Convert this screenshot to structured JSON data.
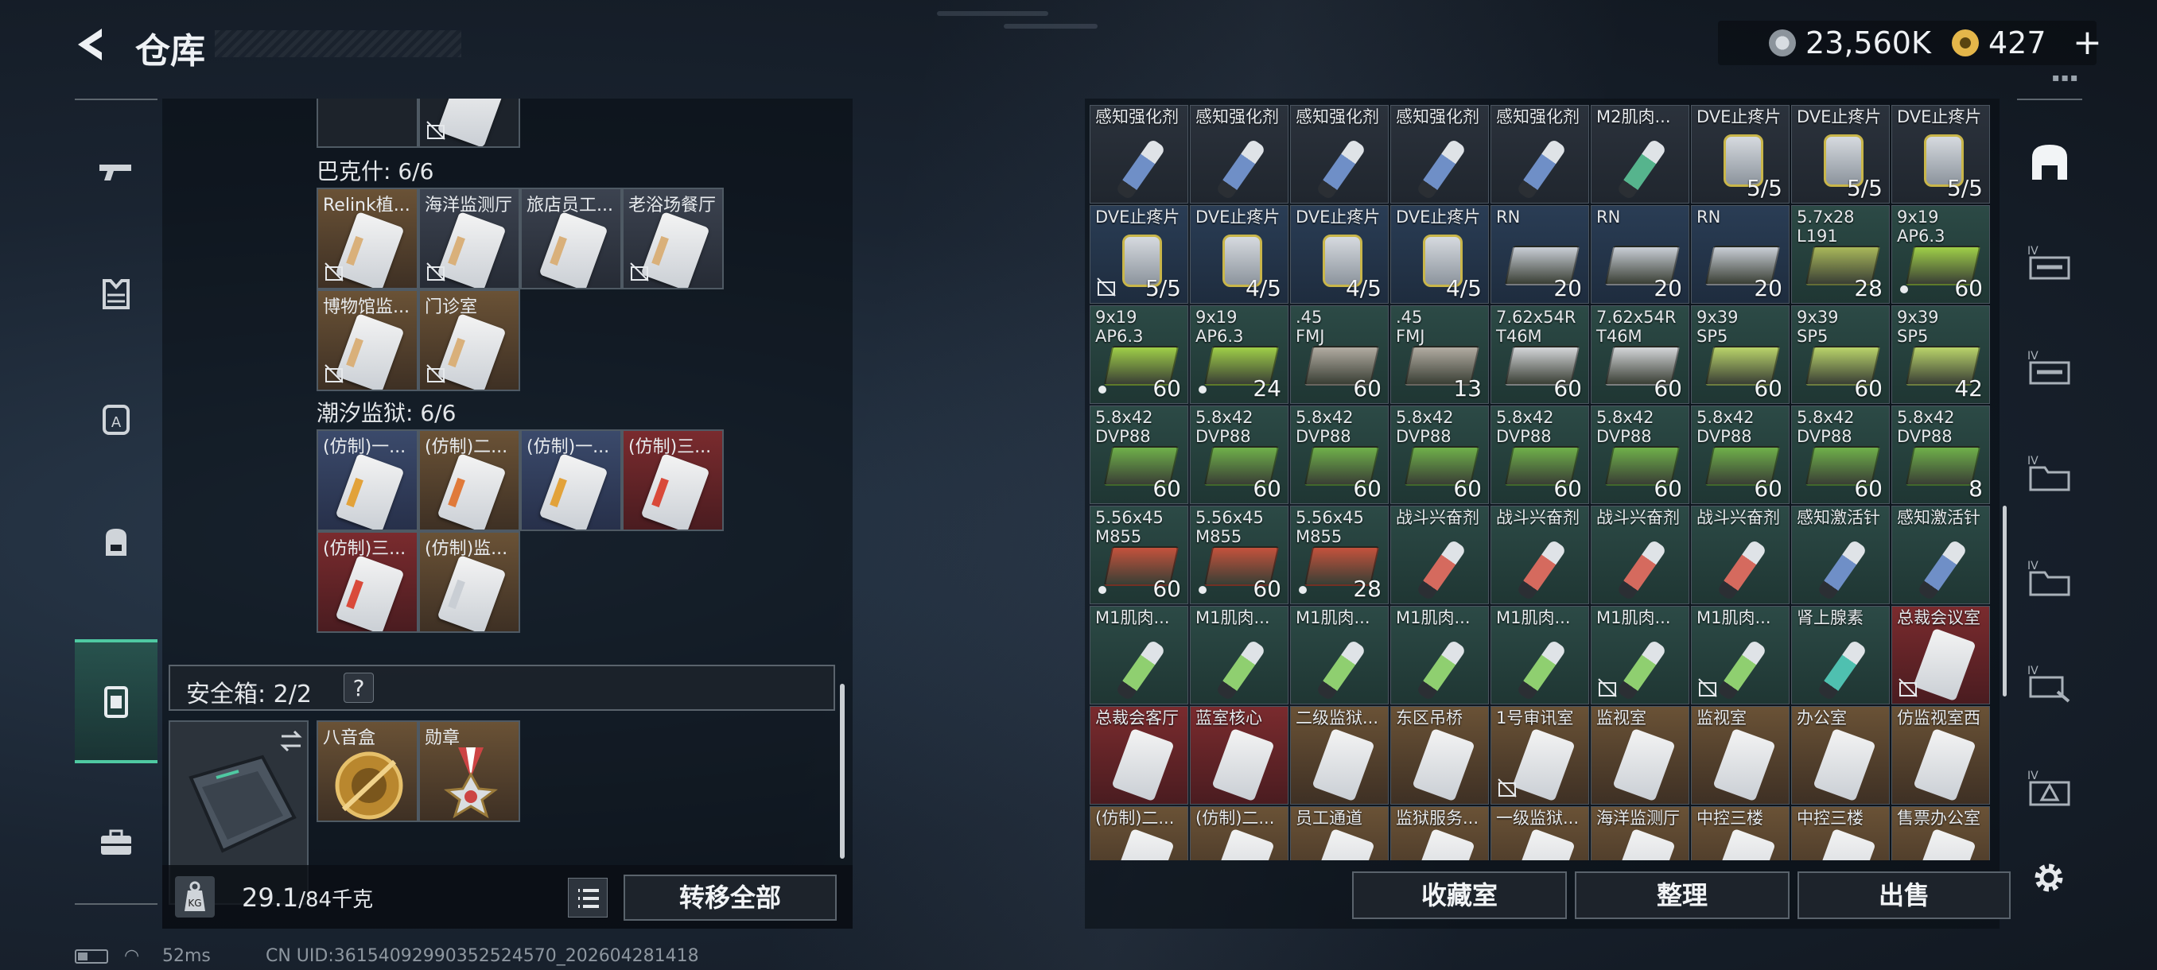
{
  "header": {
    "title": "仓库",
    "silver": "23,560K",
    "gold": "427",
    "plus": "+"
  },
  "status": {
    "ping": "52ms",
    "uid": "CN UID:36154092990352524570_202604281418"
  },
  "left": {
    "sections": [
      {
        "title": "巴克什: 6/6",
        "items": [
          {
            "label": "Relink植...",
            "color": "brown",
            "locked": true
          },
          {
            "label": "海洋监测厅",
            "color": "grey",
            "locked": true
          },
          {
            "label": "旅店员工...",
            "color": "grey",
            "locked": false
          },
          {
            "label": "老浴场餐厅",
            "color": "grey",
            "locked": true
          },
          {
            "label": "博物馆监...",
            "color": "brown",
            "locked": true
          },
          {
            "label": "门诊室",
            "color": "brown",
            "locked": true
          }
        ]
      },
      {
        "title": "潮汐监狱: 6/6",
        "items": [
          {
            "label": "(仿制)一...",
            "color": "blue",
            "locked": false
          },
          {
            "label": "(仿制)二...",
            "color": "brown",
            "locked": false
          },
          {
            "label": "(仿制)一...",
            "color": "blue",
            "locked": false
          },
          {
            "label": "(仿制)三...",
            "color": "red",
            "locked": false
          },
          {
            "label": "(仿制)三...",
            "color": "red",
            "locked": false
          },
          {
            "label": "(仿制)监...",
            "color": "brown",
            "locked": false
          }
        ]
      }
    ],
    "safebox": {
      "label": "安全箱: 2/2",
      "help": "?",
      "items": [
        {
          "label": "八音盒"
        },
        {
          "label": "勋章"
        }
      ]
    },
    "weight": {
      "current": "29.1",
      "max": "/84千克"
    },
    "transfer_all": "转移全部"
  },
  "right": {
    "rows": [
      [
        {
          "l": "感知强化剂",
          "c": "",
          "k": "syr",
          "bg": "dark",
          "t": "#6f8fc7"
        },
        {
          "l": "感知强化剂",
          "c": "",
          "k": "syr",
          "bg": "dark",
          "t": "#6f8fc7"
        },
        {
          "l": "感知强化剂",
          "c": "",
          "k": "syr",
          "bg": "dark",
          "t": "#6f8fc7"
        },
        {
          "l": "感知强化剂",
          "c": "",
          "k": "syr",
          "bg": "dark",
          "t": "#6f8fc7"
        },
        {
          "l": "感知强化剂",
          "c": "",
          "k": "syr",
          "bg": "dark",
          "t": "#6f8fc7"
        },
        {
          "l": "M2肌肉...",
          "c": "",
          "k": "syr",
          "bg": "dark",
          "t": "#56b48d"
        },
        {
          "l": "DVE止疼片",
          "c": "5/5",
          "k": "pill",
          "bg": "dark"
        },
        {
          "l": "DVE止疼片",
          "c": "5/5",
          "k": "pill",
          "bg": "dark"
        },
        {
          "l": "DVE止疼片",
          "c": "5/5",
          "k": "pill",
          "bg": "dark"
        }
      ],
      [
        {
          "l": "DVE止疼片",
          "c": "5/5",
          "k": "pill",
          "bg": "blue",
          "lock": true
        },
        {
          "l": "DVE止疼片",
          "c": "4/5",
          "k": "pill",
          "bg": "blue"
        },
        {
          "l": "DVE止疼片",
          "c": "4/5",
          "k": "pill",
          "bg": "blue"
        },
        {
          "l": "DVE止疼片",
          "c": "4/5",
          "k": "pill",
          "bg": "blue"
        },
        {
          "l": "RN",
          "c": "20",
          "k": "box",
          "bg": "blue",
          "t": "#c9ced6"
        },
        {
          "l": "RN",
          "c": "20",
          "k": "box",
          "bg": "blue",
          "t": "#c9ced6"
        },
        {
          "l": "RN",
          "c": "20",
          "k": "box",
          "bg": "blue",
          "t": "#c9ced6"
        },
        {
          "l": "5.7x28\nL191",
          "c": "28",
          "k": "box",
          "bg": "green",
          "t": "#a9b85a"
        },
        {
          "l": "9x19\nAP6.3",
          "c": "60",
          "k": "box",
          "bg": "green",
          "t": "#9fcf48",
          "dot": true
        }
      ],
      [
        {
          "l": "9x19\nAP6.3",
          "c": "60",
          "k": "box",
          "bg": "green",
          "t": "#9fcf48",
          "dot": true
        },
        {
          "l": "9x19\nAP6.3",
          "c": "24",
          "k": "box",
          "bg": "green",
          "t": "#9fcf48",
          "dot": true
        },
        {
          "l": ".45\nFMJ",
          "c": "60",
          "k": "box",
          "bg": "green",
          "t": "#b2aca2"
        },
        {
          "l": ".45\nFMJ",
          "c": "13",
          "k": "box",
          "bg": "green",
          "t": "#b2aca2"
        },
        {
          "l": "7.62x54R\nT46M",
          "c": "60",
          "k": "box",
          "bg": "green",
          "t": "#d4d6d9"
        },
        {
          "l": "7.62x54R\nT46M",
          "c": "60",
          "k": "box",
          "bg": "green",
          "t": "#d4d6d9"
        },
        {
          "l": "9x39\nSP5",
          "c": "60",
          "k": "box",
          "bg": "green",
          "t": "#b9d46a"
        },
        {
          "l": "9x39\nSP5",
          "c": "60",
          "k": "box",
          "bg": "green",
          "t": "#b9d46a"
        },
        {
          "l": "9x39\nSP5",
          "c": "42",
          "k": "box",
          "bg": "green",
          "t": "#b9d46a"
        }
      ],
      [
        {
          "l": "5.8x42\nDVP88",
          "c": "60",
          "k": "box",
          "bg": "green",
          "t": "#6fb04a"
        },
        {
          "l": "5.8x42\nDVP88",
          "c": "60",
          "k": "box",
          "bg": "green",
          "t": "#6fb04a"
        },
        {
          "l": "5.8x42\nDVP88",
          "c": "60",
          "k": "box",
          "bg": "green",
          "t": "#6fb04a"
        },
        {
          "l": "5.8x42\nDVP88",
          "c": "60",
          "k": "box",
          "bg": "green",
          "t": "#6fb04a"
        },
        {
          "l": "5.8x42\nDVP88",
          "c": "60",
          "k": "box",
          "bg": "green",
          "t": "#6fb04a"
        },
        {
          "l": "5.8x42\nDVP88",
          "c": "60",
          "k": "box",
          "bg": "green",
          "t": "#6fb04a"
        },
        {
          "l": "5.8x42\nDVP88",
          "c": "60",
          "k": "box",
          "bg": "green",
          "t": "#6fb04a"
        },
        {
          "l": "5.8x42\nDVP88",
          "c": "60",
          "k": "box",
          "bg": "green",
          "t": "#6fb04a"
        },
        {
          "l": "5.8x42\nDVP88",
          "c": "8",
          "k": "box",
          "bg": "green",
          "t": "#6fb04a"
        }
      ],
      [
        {
          "l": "5.56x45\nM855",
          "c": "60",
          "k": "box",
          "bg": "green",
          "t": "#c4523c",
          "dot": true
        },
        {
          "l": "5.56x45\nM855",
          "c": "60",
          "k": "box",
          "bg": "green",
          "t": "#c4523c",
          "dot": true
        },
        {
          "l": "5.56x45\nM855",
          "c": "28",
          "k": "box",
          "bg": "green",
          "t": "#c4523c",
          "dot": true
        },
        {
          "l": "战斗兴奋剂",
          "c": "",
          "k": "syr",
          "bg": "green",
          "t": "#d56a5e"
        },
        {
          "l": "战斗兴奋剂",
          "c": "",
          "k": "syr",
          "bg": "green",
          "t": "#d56a5e"
        },
        {
          "l": "战斗兴奋剂",
          "c": "",
          "k": "syr",
          "bg": "green",
          "t": "#d56a5e"
        },
        {
          "l": "战斗兴奋剂",
          "c": "",
          "k": "syr",
          "bg": "green",
          "t": "#d56a5e"
        },
        {
          "l": "感知激活针",
          "c": "",
          "k": "syr",
          "bg": "green",
          "t": "#6f8fc7"
        },
        {
          "l": "感知激活针",
          "c": "",
          "k": "syr",
          "bg": "green",
          "t": "#6f8fc7"
        }
      ],
      [
        {
          "l": "M1肌肉...",
          "c": "",
          "k": "syr",
          "bg": "green",
          "t": "#8fcf70"
        },
        {
          "l": "M1肌肉...",
          "c": "",
          "k": "syr",
          "bg": "green",
          "t": "#8fcf70"
        },
        {
          "l": "M1肌肉...",
          "c": "",
          "k": "syr",
          "bg": "green",
          "t": "#8fcf70"
        },
        {
          "l": "M1肌肉...",
          "c": "",
          "k": "syr",
          "bg": "green",
          "t": "#8fcf70"
        },
        {
          "l": "M1肌肉...",
          "c": "",
          "k": "syr",
          "bg": "green",
          "t": "#8fcf70"
        },
        {
          "l": "M1肌肉...",
          "c": "",
          "k": "syr",
          "bg": "green",
          "t": "#8fcf70",
          "lock": true
        },
        {
          "l": "M1肌肉...",
          "c": "",
          "k": "syr",
          "bg": "green",
          "t": "#8fcf70",
          "lock": true
        },
        {
          "l": "肾上腺素",
          "c": "",
          "k": "syr",
          "bg": "green",
          "t": "#4fc0b0"
        },
        {
          "l": "总裁会议室",
          "c": "",
          "k": "slotcard",
          "bg": "red",
          "lock": true
        }
      ],
      [
        {
          "l": "总裁会客厅",
          "c": "",
          "k": "slotcard",
          "bg": "red"
        },
        {
          "l": "蓝室核心",
          "c": "",
          "k": "slotcard",
          "bg": "red"
        },
        {
          "l": "二级监狱...",
          "c": "",
          "k": "slotcard",
          "bg": "brown"
        },
        {
          "l": "东区吊桥",
          "c": "",
          "k": "slotcard",
          "bg": "brown"
        },
        {
          "l": "1号审讯室",
          "c": "",
          "k": "slotcard",
          "bg": "brown",
          "lock": true
        },
        {
          "l": "监视室",
          "c": "",
          "k": "slotcard",
          "bg": "brown"
        },
        {
          "l": "监视室",
          "c": "",
          "k": "slotcard",
          "bg": "brown"
        },
        {
          "l": "办公室",
          "c": "",
          "k": "slotcard",
          "bg": "brown"
        },
        {
          "l": "仿监视室西",
          "c": "",
          "k": "slotcard",
          "bg": "brown"
        }
      ],
      [
        {
          "l": "(仿制)二...",
          "c": "",
          "k": "slotcard",
          "bg": "brown"
        },
        {
          "l": "(仿制)二...",
          "c": "",
          "k": "slotcard",
          "bg": "brown"
        },
        {
          "l": "员工通道",
          "c": "",
          "k": "slotcard",
          "bg": "brown"
        },
        {
          "l": "监狱服务...",
          "c": "",
          "k": "slotcard",
          "bg": "brown"
        },
        {
          "l": "一级监狱...",
          "c": "",
          "k": "slotcard",
          "bg": "brown"
        },
        {
          "l": "海洋监测厅",
          "c": "",
          "k": "slotcard",
          "bg": "brown"
        },
        {
          "l": "中控三楼",
          "c": "",
          "k": "slotcard",
          "bg": "brown"
        },
        {
          "l": "中控三楼",
          "c": "",
          "k": "slotcard",
          "bg": "brown"
        },
        {
          "l": "售票办公室",
          "c": "",
          "k": "slotcard",
          "bg": "brown"
        }
      ]
    ],
    "buttons": {
      "collection": "收藏室",
      "organize": "整理",
      "sell": "出售"
    }
  },
  "colors": {
    "accent": "#4fc9a2",
    "panel": "#0b1017"
  },
  "icons": {
    "sidebar": [
      "gun-icon",
      "armor-icon",
      "backpack-a-icon",
      "backpack-icon",
      "safebox-icon",
      "toolbox-icon"
    ],
    "right_tabs": [
      "storage-icon",
      "weapon-case-icon",
      "weapon-case-icon",
      "folder-case-icon",
      "folder-case-icon",
      "hand-case-icon",
      "warning-case-icon"
    ]
  }
}
